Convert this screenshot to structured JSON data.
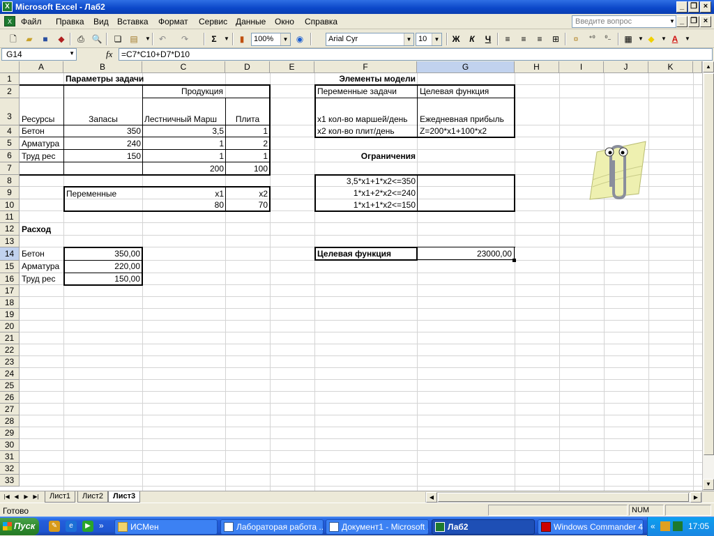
{
  "window": {
    "title": "Microsoft Excel - Лаб2",
    "icon": "excel-icon"
  },
  "menu": {
    "items": [
      "Файл",
      "Правка",
      "Вид",
      "Вставка",
      "Формат",
      "Сервис",
      "Данные",
      "Окно",
      "Справка"
    ],
    "help_placeholder": "Введите вопрос"
  },
  "toolbar": {
    "zoom": "100%",
    "font": "Arial Cyr",
    "size": "10",
    "bold": "Ж",
    "italic": "К",
    "underline": "Ч",
    "sigma": "Σ"
  },
  "formula": {
    "cell": "G14",
    "fx": "fx",
    "content": "=C7*C10+D7*D10"
  },
  "columns": [
    "A",
    "B",
    "C",
    "D",
    "E",
    "F",
    "G",
    "H",
    "I",
    "J",
    "K"
  ],
  "rows": [
    "1",
    "2",
    "3",
    "4",
    "5",
    "6",
    "7",
    "8",
    "9",
    "10",
    "11",
    "12",
    "13",
    "14",
    "15",
    "16",
    "17",
    "18",
    "19",
    "20",
    "21",
    "22",
    "23",
    "24",
    "25",
    "26",
    "27",
    "28",
    "29",
    "30",
    "31",
    "32",
    "33"
  ],
  "cells": {
    "B1": "Параметры задачи",
    "C2": "Продукция",
    "A3": "Ресурсы",
    "B3": "Запасы",
    "C3": "Лестничный Марш",
    "D3": "Плита",
    "A4": "Бетон",
    "B4": "350",
    "C4": "3,5",
    "D4": "1",
    "A5": "Арматура",
    "B5": "240",
    "C5": "1",
    "D5": "2",
    "A6": "Труд рес",
    "B6": "150",
    "C6": "1",
    "D6": "1",
    "C7": "200",
    "D7": "100",
    "B9": "Переменные",
    "C9": "x1",
    "D9": "x2",
    "C10": "80",
    "D10": "70",
    "A12": "Расход",
    "A14": "Бетон",
    "B14": "350,00",
    "A15": "Арматура",
    "B15": "220,00",
    "A16": "Труд рес",
    "B16": "150,00",
    "F1": "Элементы модели",
    "F2": "Переменные задачи",
    "G2": "Целевая функция",
    "F3": "x1 кол-во маршей/день",
    "G3": "Ежедневная прибыль",
    "F4": "x2 кол-во плит/день",
    "G4": "Z=200*x1+100*x2",
    "F6": "Ограничения",
    "F8": "3,5*x1+1*x2<=350",
    "F9": "1*x1+2*x2<=240",
    "F10": "1*x1+1*x2<=150",
    "F14": "Целевая функция",
    "G14": "23000,00"
  },
  "sheets": [
    "Лист1",
    "Лист2",
    "Лист3"
  ],
  "active_sheet": "Лист3",
  "status": {
    "text": "Готово",
    "num": "NUM"
  },
  "taskbar": {
    "start": "Пуск",
    "tasks": [
      "ИСМен",
      "Лабораторая работа ...",
      "Документ1 - Microsoft ...",
      "Лаб2",
      "Windows Commander 4..."
    ],
    "active": "Лаб2",
    "clock": "17:05"
  }
}
